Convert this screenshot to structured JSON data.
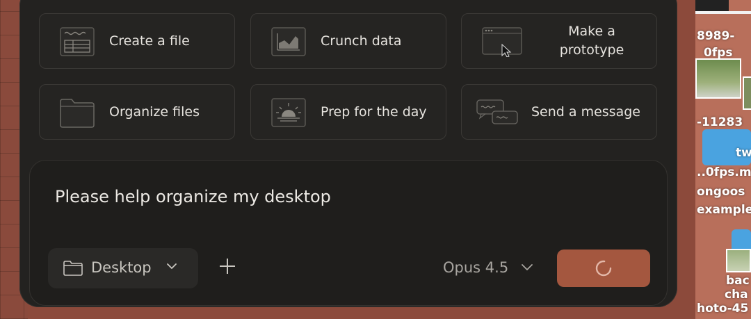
{
  "suggestions": [
    {
      "label": "Create a file",
      "icon": "spreadsheet-icon"
    },
    {
      "label": "Crunch data",
      "icon": "chart-icon"
    },
    {
      "label": "Make a prototype",
      "icon": "window-cursor-icon"
    },
    {
      "label": "Organize files",
      "icon": "folder-icon"
    },
    {
      "label": "Prep for the day",
      "icon": "sunrise-icon"
    },
    {
      "label": "Send a message",
      "icon": "chat-bubbles-icon"
    }
  ],
  "composer": {
    "prompt_text": "Please help organize my desktop",
    "folder_label": "Desktop",
    "model_label": "Opus 4.5",
    "send_state": "loading"
  },
  "desktop_labels": {
    "item1": "8989-",
    "item2": "0fps",
    "item3": "-11283",
    "item4": "tw",
    "item5": "..0fps.m",
    "item6": "ongoos",
    "item7": "example",
    "item8": "bac",
    "item9": "cha",
    "item10": "hoto-45"
  },
  "colors": {
    "panel_bg": "#232220",
    "accent_send": "#a4573f",
    "desktop_bg": "#b86f5b"
  }
}
